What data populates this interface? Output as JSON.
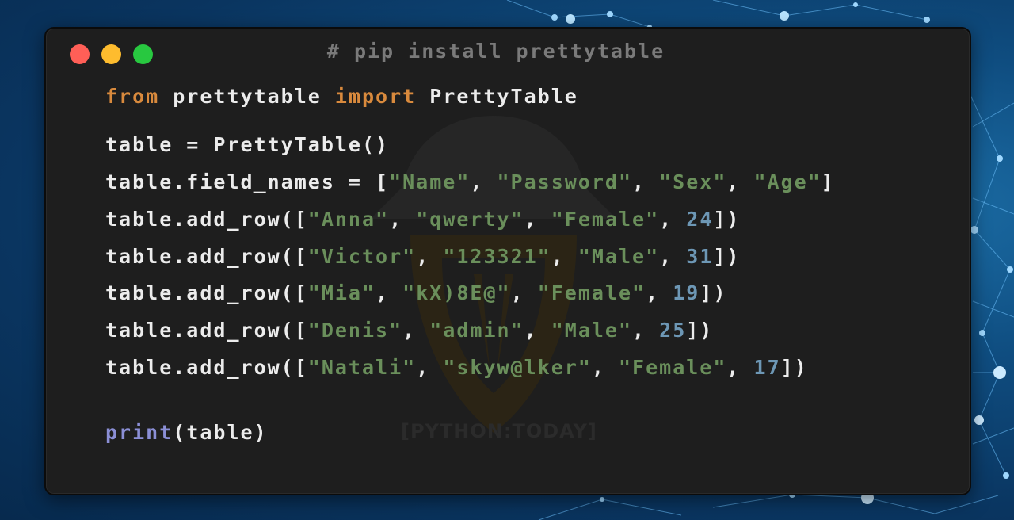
{
  "window": {
    "title": "# pip install prettytable",
    "watermark": "[PYTHON:TODAY]"
  },
  "colors": {
    "keyword": "#d98a3d",
    "string": "#6a8f5b",
    "number": "#6d97b5",
    "builtin": "#8b8fd6",
    "text": "#ececec",
    "editor_bg": "#1e1e1e"
  },
  "code": {
    "line1": {
      "kw1": "from",
      "mod": " prettytable ",
      "kw2": "import",
      "cls": " PrettyTable"
    },
    "line2": {
      "text": "table = PrettyTable()"
    },
    "line3": {
      "pre": "table.field_names = [",
      "s1": "\"Name\"",
      "c1": ", ",
      "s2": "\"Password\"",
      "c2": ", ",
      "s3": "\"Sex\"",
      "c3": ", ",
      "s4": "\"Age\"",
      "post": "]"
    },
    "rows": [
      {
        "pre": "table.add_row([",
        "s1": "\"Anna\"",
        "s2": "\"qwerty\"",
        "s3": "\"Female\"",
        "n": "24",
        "post": "])"
      },
      {
        "pre": "table.add_row([",
        "s1": "\"Victor\"",
        "s2": "\"123321\"",
        "s3": "\"Male\"",
        "n": "31",
        "post": "])"
      },
      {
        "pre": "table.add_row([",
        "s1": "\"Mia\"",
        "s2": "\"kX)8E@\"",
        "s3": "\"Female\"",
        "n": "19",
        "post": "])"
      },
      {
        "pre": "table.add_row([",
        "s1": "\"Denis\"",
        "s2": "\"admin\"",
        "s3": "\"Male\"",
        "n": "25",
        "post": "])"
      },
      {
        "pre": "table.add_row([",
        "s1": "\"Natali\"",
        "s2": "\"skyw@lker\"",
        "s3": "\"Female\"",
        "n": "17",
        "post": "])"
      }
    ],
    "comma": ", ",
    "print_line": {
      "fn": "print",
      "args": "(table)"
    }
  }
}
